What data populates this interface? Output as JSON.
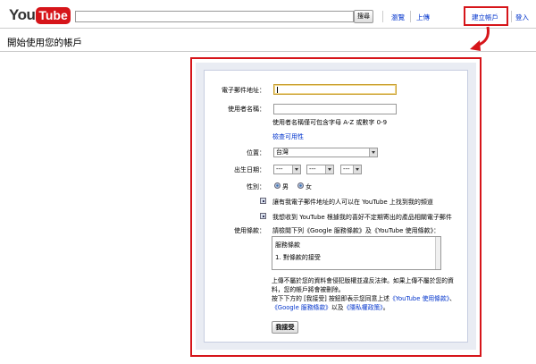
{
  "header": {
    "logo_you": "You",
    "logo_tube": "Tube",
    "search_button": "搜尋",
    "browse": "瀏覽",
    "upload": "上傳",
    "create_account": "建立帳戶",
    "sign_in": "登入"
  },
  "page_title": "開始使用您的帳戶",
  "form": {
    "email_label": "電子郵件地址：",
    "username_label": "使用者名稱：",
    "username_hint": "使用者名稱僅可包含字母 A-Z 或數字 0-9",
    "check_availability": "檢查可用性",
    "location_label": "位置：",
    "location_value": "台灣",
    "birthday_label": "出生日期：",
    "birthday_month": "---",
    "birthday_day": "---",
    "birthday_year": "---",
    "gender_label": "性別：",
    "gender_male": "男",
    "gender_female": "女",
    "checkbox_find_me": "讓有我電子郵件地址的人可以在 YouTube 上找到我的頻道",
    "checkbox_email": "我想收到 YouTube 根據我的喜好不定期寄出的產品相關電子郵件",
    "terms_label": "使用條款：",
    "terms_instruction": "請檢閱下列《Google 服務條款》及《YouTube 使用條款》：",
    "terms_box_line1": "服務條款",
    "terms_box_line2": "1. 對條款的接受",
    "upload_notice": "上傳不屬於您的資料會侵犯版權並違反法律。如果上傳不屬於您的資料，您的帳戶將會被刪除。",
    "agree_prefix": "按下下方的 [我接受] 按鈕即表示您同意上述",
    "agree_youtube_terms": "《YouTube 使用條款》",
    "agree_sep": "、",
    "agree_google_terms": "《Google 服務條款》",
    "agree_and": "以及",
    "agree_privacy": "《隱私權政策》",
    "agree_end": "。",
    "accept_button": "我接受"
  },
  "colors": {
    "highlight_red": "#d6151a",
    "link_blue": "#0033cc",
    "panel_bg": "#e9ecf3"
  }
}
